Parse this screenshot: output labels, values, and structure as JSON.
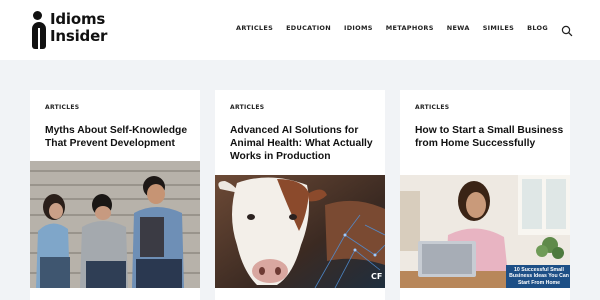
{
  "logo": {
    "line1": "Idioms",
    "line2": "Insider"
  },
  "nav": [
    "ARTICLES",
    "EDUCATION",
    "IDIOMS",
    "METAPHORS",
    "NEWA",
    "SIMILES",
    "BLOG"
  ],
  "search_icon": "search-icon",
  "cards": [
    {
      "category": "ARTICLES",
      "title": "Myths About Self-Knowledge That Prevent Development"
    },
    {
      "category": "ARTICLES",
      "title": "Advanced AI Solutions for Animal Health: What Actually Works in Production",
      "image_watermark": "CF"
    },
    {
      "category": "ARTICLES",
      "title": "How to Start a Small Business from Home Successfully",
      "image_caption": "10 Successful Small Business Ideas You Can Start From Home"
    }
  ],
  "colors": {
    "background": "#f1f3f6",
    "card": "#ffffff",
    "text": "#111111"
  }
}
